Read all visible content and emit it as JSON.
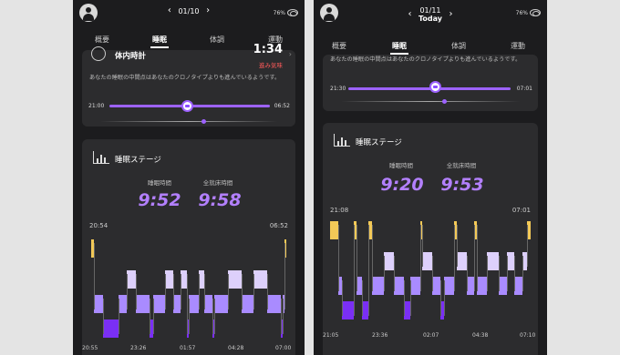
{
  "colors": {
    "awake": "#f3c957",
    "rem": "#ddd0fb",
    "light": "#a98bff",
    "deep": "#7a2ff5",
    "accent": "#b380ff",
    "red": "#ff5a5a"
  },
  "left": {
    "date": "01/10",
    "battery": "76%",
    "tabs": [
      "概要",
      "睡眠",
      "体調",
      "運動"
    ],
    "active_tab": 1,
    "clock_title": "体内時計",
    "clock_value": "1:34",
    "clock_status": "進み気味",
    "clock_desc": "あなたの睡眠の中間点はあなたのクロノタイプよりも進んでいるようです。",
    "slider_start": "21:00",
    "slider_end": "06:52",
    "stage_title": "睡眠ステージ",
    "sleep_time_label": "睡眠時間",
    "sleep_time": "9:52",
    "bed_time_label": "全就床時間",
    "bed_time": "9:58",
    "start_time": "20:54",
    "end_time": "06:52",
    "axis": [
      "20:55",
      "23:26",
      "01:57",
      "04:28",
      "07:00"
    ]
  },
  "right": {
    "date": "01/11",
    "date_sub": "Today",
    "battery": "76%",
    "tabs": [
      "概要",
      "睡眠",
      "体調",
      "運動"
    ],
    "active_tab": 1,
    "clock_desc": "あなたの睡眠の中間点はあなたのクロノタイプよりも進んでいるようです。",
    "slider_start": "21:30",
    "slider_end": "07:01",
    "stage_title": "睡眠ステージ",
    "sleep_time_label": "睡眠時間",
    "sleep_time": "9:20",
    "bed_time_label": "全就床時間",
    "bed_time": "9:53",
    "start_time": "21:08",
    "end_time": "07:01",
    "axis": [
      "21:05",
      "23:36",
      "02:07",
      "04:38",
      "07:10"
    ]
  }
}
